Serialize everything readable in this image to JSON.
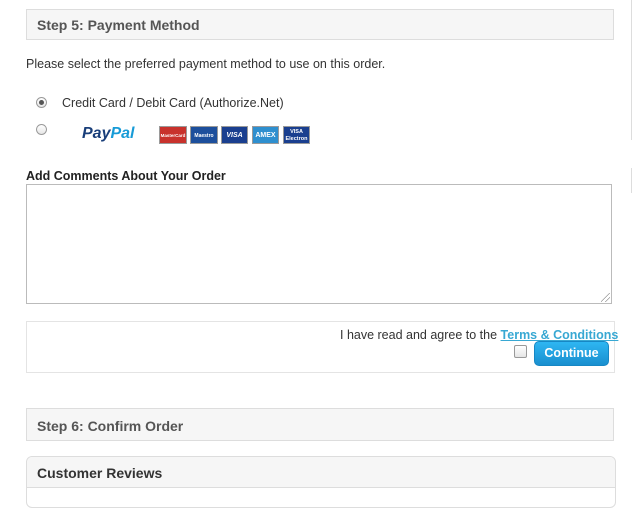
{
  "step5": {
    "title": "Step 5: Payment Method"
  },
  "payment": {
    "instruction": "Please select the preferred payment method to use on this order.",
    "options": [
      {
        "label": "Credit Card / Debit Card (Authorize.Net)",
        "selected": true
      },
      {
        "label": "PayPal",
        "selected": false
      }
    ],
    "paypal_logo": {
      "pay": "Pay",
      "pal": "Pal",
      "pay_color": "#1a3f7a",
      "pal_color": "#179bd7"
    },
    "cards": [
      {
        "label": "MasterCard",
        "color": "#c8322c"
      },
      {
        "label": "Maestro",
        "color": "#1d4f9c"
      },
      {
        "label": "VISA",
        "color": "#1a3f8f"
      },
      {
        "label": "AMEX",
        "color": "#2e8fcf"
      },
      {
        "label": "VISA Electron",
        "color": "#1a3f8f"
      }
    ]
  },
  "comments": {
    "label": "Add Comments About Your Order",
    "value": ""
  },
  "agreement": {
    "text": "I have read and agree to the ",
    "link_text": "Terms & Conditions",
    "checked": false
  },
  "continue_button": {
    "label": "Continue",
    "color": "#1fa3e3"
  },
  "step6": {
    "title": "Step 6: Confirm Order"
  },
  "reviews": {
    "title": "Customer Reviews"
  },
  "colors": {
    "link": "#38a8d3",
    "header_bg": "#f6f6f6",
    "border": "#dddddd"
  }
}
